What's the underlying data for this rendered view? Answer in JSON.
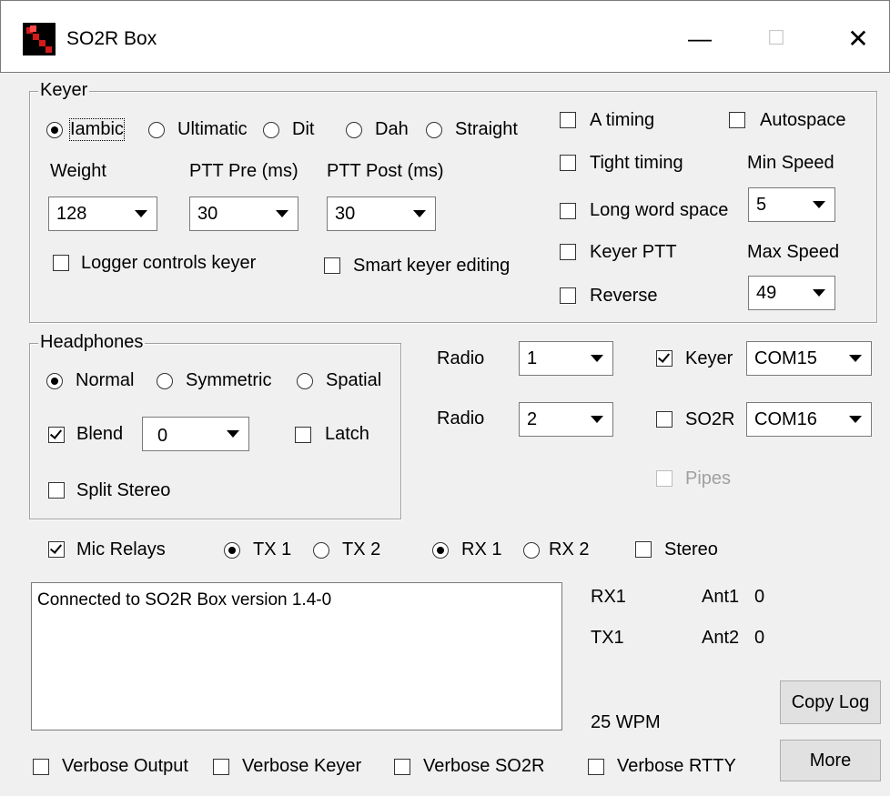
{
  "window": {
    "title": "SO2R Box",
    "minimize": "—",
    "maximize": "☐",
    "close": "✕"
  },
  "keyer": {
    "group_label": "Keyer",
    "modes": [
      "Iambic",
      "Ultimatic",
      "Dit",
      "Dah",
      "Straight"
    ],
    "selected_mode": "Iambic",
    "weight_label": "Weight",
    "weight_value": "128",
    "ptt_pre_label": "PTT Pre (ms)",
    "ptt_pre_value": "30",
    "ptt_post_label": "PTT Post (ms)",
    "ptt_post_value": "30",
    "logger_controls": "Logger controls keyer",
    "smart_editing": "Smart keyer editing",
    "a_timing": "A timing",
    "autospace": "Autospace",
    "tight_timing": "Tight timing",
    "min_speed_label": "Min Speed",
    "min_speed_value": "5",
    "long_word_space": "Long word space",
    "keyer_ptt": "Keyer PTT",
    "max_speed_label": "Max Speed",
    "max_speed_value": "49",
    "reverse": "Reverse"
  },
  "headphones": {
    "group_label": "Headphones",
    "modes": [
      "Normal",
      "Symmetric",
      "Spatial"
    ],
    "selected_mode": "Normal",
    "blend_label": "Blend",
    "blend_checked": true,
    "blend_value": "0",
    "latch": "Latch",
    "split_stereo": "Split Stereo"
  },
  "radios": {
    "radio1_label": "Radio",
    "radio1_value": "1",
    "radio2_label": "Radio",
    "radio2_value": "2",
    "keyer_label": "Keyer",
    "keyer_checked": true,
    "keyer_port": "COM15",
    "so2r_label": "SO2R",
    "so2r_checked": false,
    "so2r_port": "COM16",
    "pipes_label": "Pipes"
  },
  "relays": {
    "mic_relays": "Mic Relays",
    "mic_checked": true,
    "tx1": "TX 1",
    "tx2": "TX 2",
    "tx_selected": "TX 1",
    "rx1": "RX 1",
    "rx2": "RX 2",
    "rx_selected": "RX 1",
    "stereo": "Stereo"
  },
  "log": {
    "text": "Connected to SO2R Box version 1.4-0"
  },
  "status": {
    "rx": "RX1",
    "tx": "TX1",
    "ant1_label": "Ant1",
    "ant1_value": "0",
    "ant2_label": "Ant2",
    "ant2_value": "0",
    "wpm": "25 WPM"
  },
  "buttons": {
    "copy_log": "Copy Log",
    "more": "More"
  },
  "verbose": {
    "output": "Verbose Output",
    "keyer": "Verbose Keyer",
    "so2r": "Verbose SO2R",
    "rtty": "Verbose RTTY"
  }
}
